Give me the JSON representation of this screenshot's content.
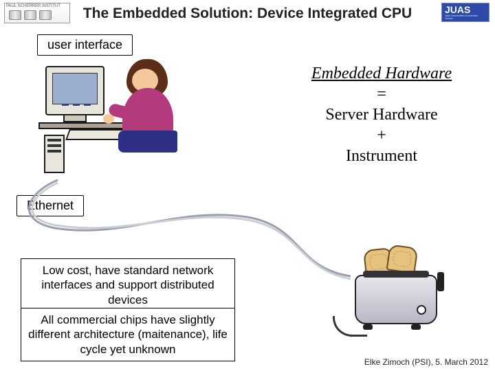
{
  "title": "The Embedded Solution: Device Integrated CPU",
  "logos": {
    "psi_caption": "PAUL SCHERRER INSTITUT",
    "juas_main": "JUAS",
    "juas_sub": "Joint Universities Accelerator School"
  },
  "labels": {
    "user_interface": "user interface",
    "ethernet": "Ethernet"
  },
  "equation": {
    "heading": "Embedded Hardware",
    "eq1": "=",
    "line2": "Server Hardware",
    "plus": "+",
    "line3": "Instrument"
  },
  "blurbs": {
    "b1": "Low cost, have standard network interfaces and support distributed devices",
    "b2": "All commercial chips have slightly different architecture (maitenance), life cycle yet unknown"
  },
  "footer": "Elke Zimoch (PSI), 5. March 2012"
}
